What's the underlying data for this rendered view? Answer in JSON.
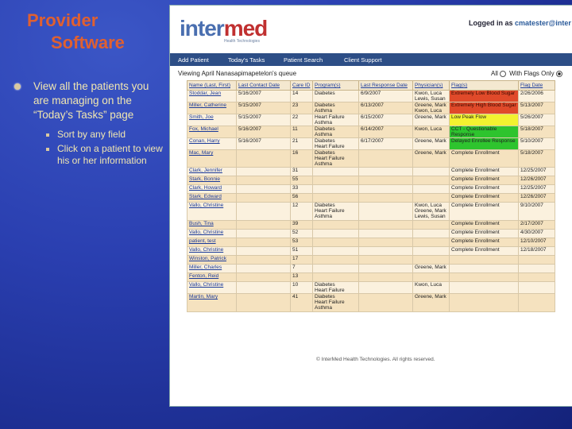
{
  "slide": {
    "title_line1": "Provider",
    "title_line2": "Software",
    "bullet": "View all the patients you are managing on the “Today’s Tasks” page",
    "subbullets": [
      "Sort by any field",
      "Click on a patient to view his or her information"
    ]
  },
  "app": {
    "logo_text_a": "inter",
    "logo_text_b": "med",
    "logo_tag": "Health Technologies",
    "logged_in_label": "Logged in as",
    "username": "cmatester@inter",
    "nav": [
      "Add Patient",
      "Today's Tasks",
      "Patient Search",
      "Client Support"
    ],
    "queue_title": "Viewing April Nanasapimapetelon's queue",
    "filter_all": "All",
    "filter_flags": "With Flags Only",
    "columns": [
      "Name (Last, First)",
      "Last Contact Date",
      "Care ID",
      "Program(s)",
      "Last Response Date",
      "Physician(s)",
      "Flag(s)",
      "Flag Date"
    ],
    "rows": [
      {
        "name": "Stoddar, Jean",
        "last_contact": "5/16/2007",
        "care_id": "14",
        "programs": "Diabetes",
        "last_response": "6/9/2007",
        "physicians": "Kwon, Luca\nLewis, Susan",
        "flag": "Extremely Low Blood Sugar",
        "flag_color": "red",
        "flag_date": "2/26/2006"
      },
      {
        "name": "Miller, Catherine",
        "last_contact": "5/15/2007",
        "care_id": "23",
        "programs": "Diabetes\nAsthma",
        "last_response": "6/13/2007",
        "physicians": "Greene, Mark\nKwon, Luca",
        "flag": "Extremely High Blood Sugar",
        "flag_color": "red",
        "flag_date": "5/13/2007"
      },
      {
        "name": "Smith, Joe",
        "last_contact": "5/15/2007",
        "care_id": "22",
        "programs": "Heart Failure\nAsthma",
        "last_response": "6/15/2007",
        "physicians": "Greene, Mark",
        "flag": "Low Peak Flow",
        "flag_color": "yellow",
        "flag_date": "5/26/2007"
      },
      {
        "name": "Fox, Michael",
        "last_contact": "5/16/2007",
        "care_id": "11",
        "programs": "Diabetes\nAsthma",
        "last_response": "6/14/2007",
        "physicians": "Kwon, Luca",
        "flag": "CCT - Questionable Response",
        "flag_color": "green",
        "flag_date": "5/18/2007"
      },
      {
        "name": "Conan, Harry",
        "last_contact": "5/16/2007",
        "care_id": "21",
        "programs": "Diabetes\nHeart Failure",
        "last_response": "6/17/2007",
        "physicians": "Greene, Mark",
        "flag": "Delayed Enrollee Response",
        "flag_color": "green",
        "flag_date": "5/10/2007"
      },
      {
        "name": "Mac, Mary",
        "last_contact": "",
        "care_id": "16",
        "programs": "Diabetes\nHeart Failure\nAsthma",
        "last_response": "",
        "physicians": "Greene, Mark",
        "flag": "Complete Enrollment",
        "flag_color": "",
        "flag_date": "5/18/2007"
      },
      {
        "name": "Clark, Jennifer",
        "last_contact": "",
        "care_id": "31",
        "programs": "",
        "last_response": "",
        "physicians": "",
        "flag": "Complete Enrollment",
        "flag_color": "",
        "flag_date": "12/25/2007"
      },
      {
        "name": "Stark, Bonnie",
        "last_contact": "",
        "care_id": "55",
        "programs": "",
        "last_response": "",
        "physicians": "",
        "flag": "Complete Enrollment",
        "flag_color": "",
        "flag_date": "12/26/2007"
      },
      {
        "name": "Clark, Howard",
        "last_contact": "",
        "care_id": "33",
        "programs": "",
        "last_response": "",
        "physicians": "",
        "flag": "Complete Enrollment",
        "flag_color": "",
        "flag_date": "12/25/2007"
      },
      {
        "name": "Stark, Edward",
        "last_contact": "",
        "care_id": "56",
        "programs": "",
        "last_response": "",
        "physicians": "",
        "flag": "Complete Enrollment",
        "flag_color": "",
        "flag_date": "12/26/2007"
      },
      {
        "name": "Vallo, Christine",
        "last_contact": "",
        "care_id": "12",
        "programs": "Diabetes\nHeart Failure\nAsthma",
        "last_response": "",
        "physicians": "Kwon, Luca\nGreene, Mark\nLewis, Susan",
        "flag": "Complete Enrollment",
        "flag_color": "",
        "flag_date": "9/10/2007"
      },
      {
        "name": "Bush, Tina",
        "last_contact": "",
        "care_id": "39",
        "programs": "",
        "last_response": "",
        "physicians": "",
        "flag": "Complete Enrollment",
        "flag_color": "",
        "flag_date": "2/17/2007"
      },
      {
        "name": "Vallo, Christine",
        "last_contact": "",
        "care_id": "52",
        "programs": "",
        "last_response": "",
        "physicians": "",
        "flag": "Complete Enrollment",
        "flag_color": "",
        "flag_date": "4/30/2007"
      },
      {
        "name": "patient, test",
        "last_contact": "",
        "care_id": "53",
        "programs": "",
        "last_response": "",
        "physicians": "",
        "flag": "Complete Enrollment",
        "flag_color": "",
        "flag_date": "12/10/2007"
      },
      {
        "name": "Vallo, Christine",
        "last_contact": "",
        "care_id": "51",
        "programs": "",
        "last_response": "",
        "physicians": "",
        "flag": "Complete Enrollment",
        "flag_color": "",
        "flag_date": "12/18/2007"
      },
      {
        "name": "Winston, Patrick",
        "last_contact": "",
        "care_id": "17",
        "programs": "",
        "last_response": "",
        "physicians": "",
        "flag": "",
        "flag_color": "",
        "flag_date": ""
      },
      {
        "name": "Miller, Charles",
        "last_contact": "",
        "care_id": "7",
        "programs": "",
        "last_response": "",
        "physicians": "Greene, Mark",
        "flag": "",
        "flag_color": "",
        "flag_date": ""
      },
      {
        "name": "Fenton, Reid",
        "last_contact": "",
        "care_id": "13",
        "programs": "",
        "last_response": "",
        "physicians": "",
        "flag": "",
        "flag_color": "",
        "flag_date": ""
      },
      {
        "name": "Vallo, Christine",
        "last_contact": "",
        "care_id": "10",
        "programs": "Diabetes\nHeart Failure",
        "last_response": "",
        "physicians": "Kwon, Luca",
        "flag": "",
        "flag_color": "",
        "flag_date": ""
      },
      {
        "name": "Martin, Mary",
        "last_contact": "",
        "care_id": "41",
        "programs": "Diabetes\nHeart Failure\nAsthma",
        "last_response": "",
        "physicians": "Greene, Mark",
        "flag": "",
        "flag_color": "",
        "flag_date": ""
      }
    ],
    "footer": "© InterMed Health Technologies. All rights reserved."
  }
}
